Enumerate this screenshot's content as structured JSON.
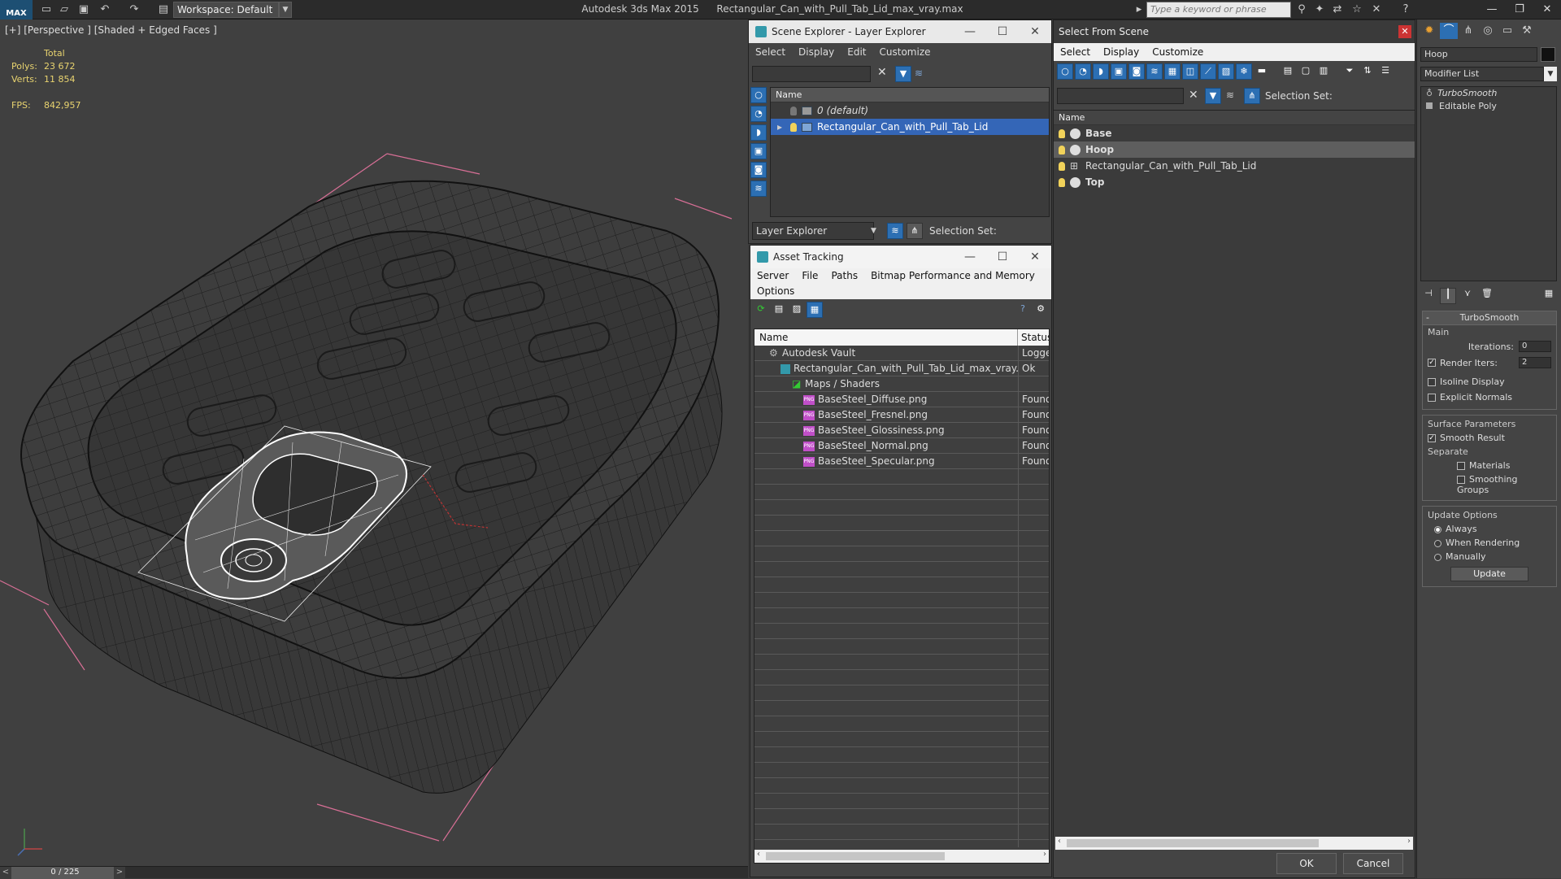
{
  "titlebar": {
    "logo": "MAX",
    "workspace": "Workspace: Default",
    "app_name": "Autodesk 3ds Max  2015",
    "file_name": "Rectangular_Can_with_Pull_Tab_Lid_max_vray.max",
    "search_placeholder": "Type a keyword or phrase"
  },
  "viewport": {
    "label": "[+] [Perspective ] [Shaded + Edged Faces ]",
    "stats": {
      "total_label": "Total",
      "polys_label": "Polys:",
      "polys": "23 672",
      "verts_label": "Verts:",
      "verts": "11 854",
      "fps_label": "FPS:",
      "fps": "842,957"
    }
  },
  "timeline": {
    "frame": "0 / 225",
    "prev": "<",
    "next": ">"
  },
  "scene_explorer": {
    "title": "Scene Explorer - Layer Explorer",
    "menu": [
      "Select",
      "Display",
      "Edit",
      "Customize"
    ],
    "column": "Name",
    "rows": [
      "0 (default)",
      "Rectangular_Can_with_Pull_Tab_Lid"
    ],
    "footer_dropdown": "Layer Explorer",
    "selection_set_label": "Selection Set:"
  },
  "asset_tracking": {
    "title": "Asset Tracking",
    "menu": [
      "Server",
      "File",
      "Paths",
      "Bitmap Performance and Memory"
    ],
    "menu2": "Options",
    "col_name": "Name",
    "col_status": "Status",
    "rows": [
      {
        "name": "Autodesk Vault",
        "status": "Logged",
        "indent": 0
      },
      {
        "name": "Rectangular_Can_with_Pull_Tab_Lid_max_vray.m...",
        "status": "Ok",
        "indent": 1
      },
      {
        "name": "Maps / Shaders",
        "status": "",
        "indent": 2
      },
      {
        "name": "BaseSteel_Diffuse.png",
        "status": "Found",
        "indent": 3
      },
      {
        "name": "BaseSteel_Fresnel.png",
        "status": "Found",
        "indent": 3
      },
      {
        "name": "BaseSteel_Glossiness.png",
        "status": "Found",
        "indent": 3
      },
      {
        "name": "BaseSteel_Normal.png",
        "status": "Found",
        "indent": 3
      },
      {
        "name": "BaseSteel_Specular.png",
        "status": "Found",
        "indent": 3
      }
    ]
  },
  "select_from_scene": {
    "title": "Select From Scene",
    "menu": [
      "Select",
      "Display",
      "Customize"
    ],
    "selection_set_label": "Selection Set:",
    "column": "Name",
    "rows": [
      "Base",
      "Hoop",
      "Rectangular_Can_with_Pull_Tab_Lid",
      "Top"
    ],
    "ok": "OK",
    "cancel": "Cancel"
  },
  "command_panel": {
    "object_name": "Hoop",
    "modifier_list": "Modifier List",
    "stack": [
      "TurboSmooth",
      "Editable Poly"
    ],
    "rollout_title": "TurboSmooth",
    "main_label": "Main",
    "iterations_label": "Iterations:",
    "iterations": "0",
    "render_iters_label": "Render Iters:",
    "render_iters": "2",
    "isoline": "Isoline Display",
    "explicit_normals": "Explicit Normals",
    "surface_params": "Surface Parameters",
    "smooth_result": "Smooth Result",
    "separate": "Separate",
    "materials": "Materials",
    "smoothing_groups": "Smoothing Groups",
    "update_options": "Update Options",
    "always": "Always",
    "when_rendering": "When Rendering",
    "manually": "Manually",
    "update_btn": "Update"
  }
}
